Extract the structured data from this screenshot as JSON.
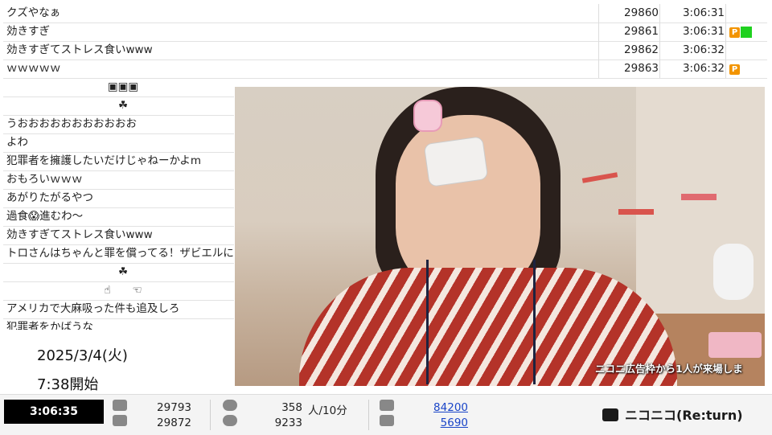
{
  "comments": [
    {
      "text": "クズやなぁ",
      "no": "29860",
      "time": "3:06:31",
      "badges": []
    },
    {
      "text": "効きすぎ",
      "no": "29861",
      "time": "3:06:31",
      "badges": [
        "P",
        "green"
      ]
    },
    {
      "text": "効きすぎてストレス食いwww",
      "no": "29862",
      "time": "3:06:32",
      "badges": []
    },
    {
      "text": "ｗｗｗｗｗ",
      "no": "29863",
      "time": "3:06:32",
      "badges": [
        "P"
      ]
    }
  ],
  "left_comments": [
    "▣▣▣",
    "☘",
    "うおおおおおおおおおおお",
    "よわ",
    "犯罪者を擁護したいだけじゃねーかよm",
    "おもろいｗｗｗ",
    "あがりたがるやつ",
    "過食😱進むわ～",
    "効きすぎてストレス食いwww",
    "トロさんはちゃんと罪を償ってる！ザビエルにもした",
    "☘",
    "☝　　☜",
    "アメリカで大麻吸った件も追及しろ",
    "犯罪者をかばうな"
  ],
  "overlay": {
    "date": "2025/3/4(火)",
    "start": "7:38開始",
    "ad_text": "ニコニ広告枠から1人が来場しま"
  },
  "footer": {
    "elapsed": "3:06:35",
    "comments_a": "29793",
    "comments_b": "29872",
    "viewers_rate": "358",
    "viewers_rate_unit": "人/10分",
    "viewers_total": "9233",
    "ad_points": "84200",
    "gift_points": "5690",
    "logo_text": "ニコニコ(Re:turn)"
  },
  "colors": {
    "p_badge": "#f29400",
    "green_badge": "#1fd11f",
    "link": "#1a45c8"
  }
}
